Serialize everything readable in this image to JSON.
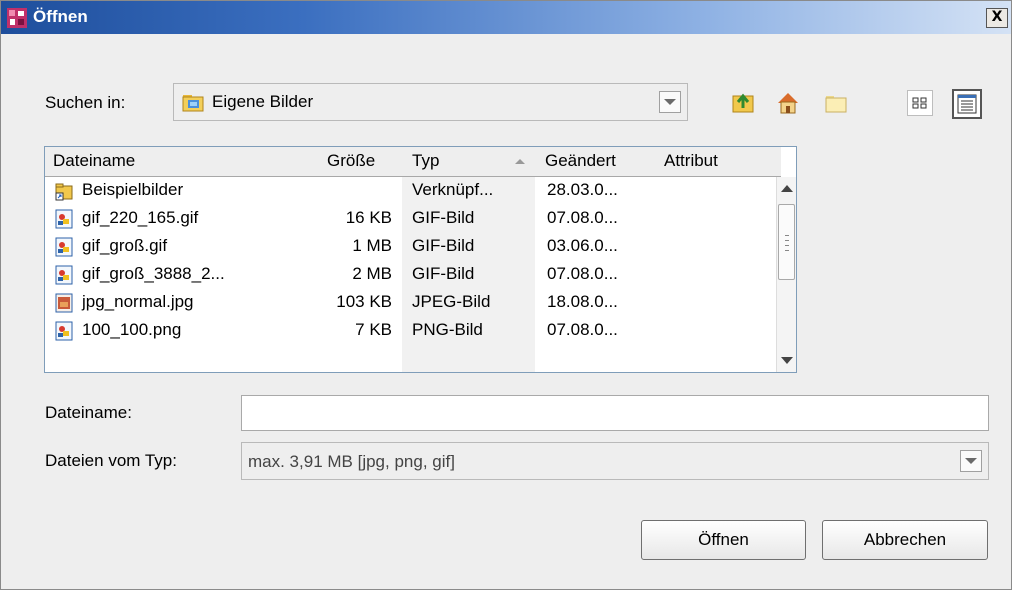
{
  "window": {
    "title": "Öffnen",
    "close_glyph": "X"
  },
  "lookin": {
    "label": "Suchen in:",
    "value": "Eigene Bilder"
  },
  "toolbar": {
    "icons": [
      "up-folder-icon",
      "home-icon",
      "new-folder-icon",
      "list-view-icon",
      "details-view-icon"
    ]
  },
  "table": {
    "headers": {
      "name": "Dateiname",
      "size": "Größe",
      "type": "Typ",
      "modified": "Geändert",
      "attr": "Attribut"
    },
    "rows": [
      {
        "name": "Beispielbilder",
        "size": "",
        "type": "Verknüpf...",
        "date": "28.03.0...",
        "icon": "folder-link-icon"
      },
      {
        "name": "gif_220_165.gif",
        "size": "16 KB",
        "type": "GIF-Bild",
        "date": "07.08.0...",
        "icon": "image-file-icon"
      },
      {
        "name": "gif_groß.gif",
        "size": "1 MB",
        "type": "GIF-Bild",
        "date": "03.06.0...",
        "icon": "image-file-icon"
      },
      {
        "name": "gif_groß_3888_2...",
        "size": "2 MB",
        "type": "GIF-Bild",
        "date": "07.08.0...",
        "icon": "image-file-icon"
      },
      {
        "name": "jpg_normal.jpg",
        "size": "103 KB",
        "type": "JPEG-Bild",
        "date": "18.08.0...",
        "icon": "jpeg-file-icon"
      },
      {
        "name": "100_100.png",
        "size": "7 KB",
        "type": "PNG-Bild",
        "date": "07.08.0...",
        "icon": "image-file-icon"
      }
    ]
  },
  "filename": {
    "label": "Dateiname:",
    "value": ""
  },
  "filetype": {
    "label": "Dateien vom Typ:",
    "value": "max. 3,91 MB [jpg, png, gif]"
  },
  "buttons": {
    "open": "Öffnen",
    "cancel": "Abbrechen"
  },
  "colors": {
    "titlebar_start": "#1e4e9c",
    "titlebar_end": "#d4e2f5",
    "dialog_bg": "#eeeeee"
  }
}
